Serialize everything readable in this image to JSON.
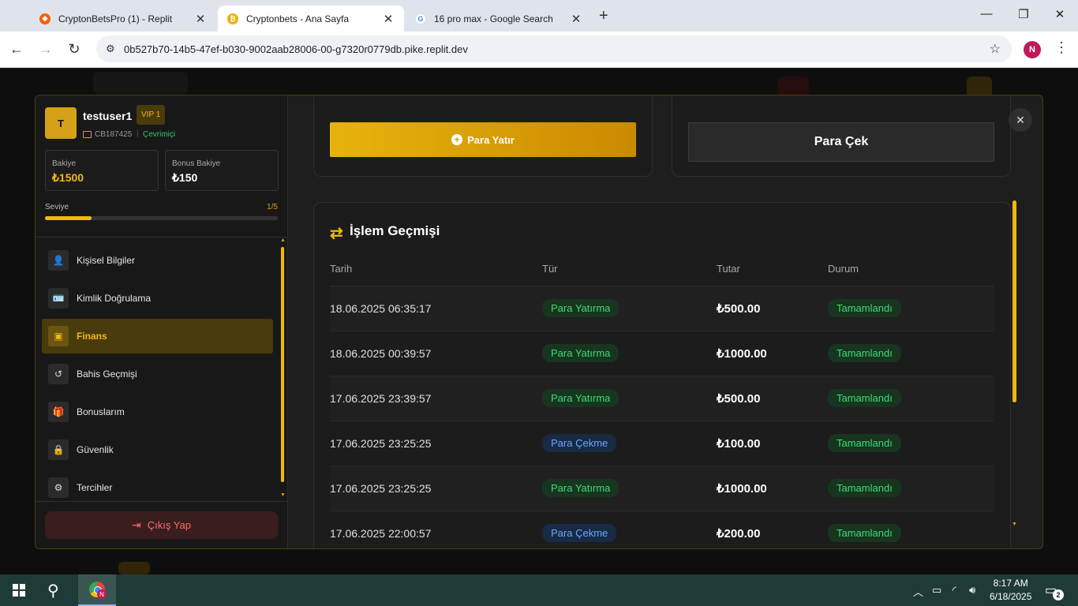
{
  "browser": {
    "tabs": [
      {
        "label": "CryptonBetsPro (1) - Replit",
        "favicon": "replit-icon",
        "favicon_color": "#f26207"
      },
      {
        "label": "Cryptonbets - Ana Sayfa",
        "favicon": "coin-icon",
        "favicon_color": "#e8b30d"
      },
      {
        "label": "16 pro max - Google Search",
        "favicon": "google-icon",
        "favicon_color": "#4285f4"
      }
    ],
    "url": "0b527b70-14b5-47ef-b030-9002aab28006-00-g7320r0779db.pike.replit.dev",
    "profile_initial": "N"
  },
  "user": {
    "avatar_initial": "T",
    "username": "testuser1",
    "vip": "VIP 1",
    "id": "CB187425",
    "separator": "|",
    "status": "Çevrimiçi"
  },
  "balances": {
    "main_label": "Bakiye",
    "main_value": "₺1500",
    "bonus_label": "Bonus Bakiye",
    "bonus_value": "₺150"
  },
  "level": {
    "label": "Seviye",
    "value": "1/5",
    "progress_percent": 20
  },
  "menu": [
    {
      "label": "Kişisel Bilgiler",
      "icon": "user-icon",
      "glyph": "👤"
    },
    {
      "label": "Kimlik Doğrulama",
      "icon": "id-card-icon",
      "glyph": "🪪"
    },
    {
      "label": "Finans",
      "icon": "wallet-icon",
      "glyph": "▣",
      "active": true
    },
    {
      "label": "Bahis Geçmişi",
      "icon": "history-icon",
      "glyph": "↺"
    },
    {
      "label": "Bonuslarım",
      "icon": "gift-icon",
      "glyph": "🎁"
    },
    {
      "label": "Güvenlik",
      "icon": "lock-icon",
      "glyph": "🔒"
    },
    {
      "label": "Tercihler",
      "icon": "gear-icon",
      "glyph": "⚙"
    }
  ],
  "logout_label": "Çıkış Yap",
  "finance": {
    "deposit_label": "Para Yatır",
    "withdraw_label": "Para Çek"
  },
  "history": {
    "title": "İşlem Geçmişi",
    "columns": [
      "Tarih",
      "Tür",
      "Tutar",
      "Durum"
    ],
    "rows": [
      {
        "date": "18.06.2025 06:35:17",
        "type": "Para Yatırma",
        "kind": "dep",
        "amount": "₺500.00",
        "status": "Tamamlandı"
      },
      {
        "date": "18.06.2025 00:39:57",
        "type": "Para Yatırma",
        "kind": "dep",
        "amount": "₺1000.00",
        "status": "Tamamlandı"
      },
      {
        "date": "17.06.2025 23:39:57",
        "type": "Para Yatırma",
        "kind": "dep",
        "amount": "₺500.00",
        "status": "Tamamlandı"
      },
      {
        "date": "17.06.2025 23:25:25",
        "type": "Para Çekme",
        "kind": "wd",
        "amount": "₺100.00",
        "status": "Tamamlandı"
      },
      {
        "date": "17.06.2025 23:25:25",
        "type": "Para Yatırma",
        "kind": "dep",
        "amount": "₺1000.00",
        "status": "Tamamlandı"
      },
      {
        "date": "17.06.2025 22:00:57",
        "type": "Para Çekme",
        "kind": "wd",
        "amount": "₺200.00",
        "status": "Tamamlandı"
      }
    ]
  },
  "taskbar": {
    "time": "8:17 AM",
    "date": "6/18/2025",
    "notifications": "2"
  },
  "colors": {
    "accent": "#f0b90b",
    "success": "#3ddc74",
    "withdraw": "#6aa8ff",
    "danger": "#ff6b6b"
  }
}
